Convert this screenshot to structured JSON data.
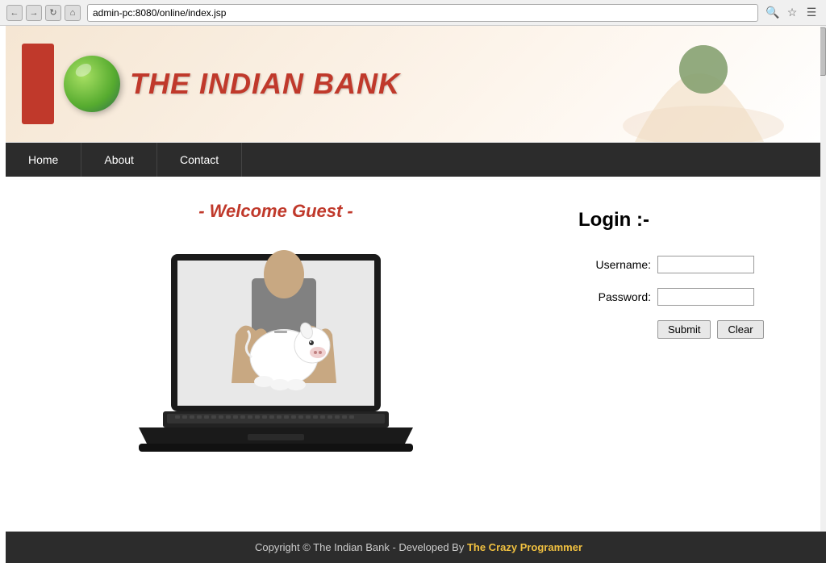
{
  "browser": {
    "url": "admin-pc:8080/online/index.jsp"
  },
  "header": {
    "logo_title": "THE INDIAN BANK"
  },
  "nav": {
    "items": [
      {
        "label": "Home",
        "id": "home"
      },
      {
        "label": "About",
        "id": "about"
      },
      {
        "label": "Contact",
        "id": "contact"
      }
    ]
  },
  "main": {
    "welcome_text": "- Welcome Guest -",
    "login": {
      "title": "Login :-",
      "username_label": "Username:",
      "password_label": "Password:",
      "submit_label": "Submit",
      "clear_label": "Clear"
    }
  },
  "footer": {
    "text": "Copyright © The Indian Bank - Developed By ",
    "link_text": "The Crazy Programmer",
    "link_url": "#"
  }
}
